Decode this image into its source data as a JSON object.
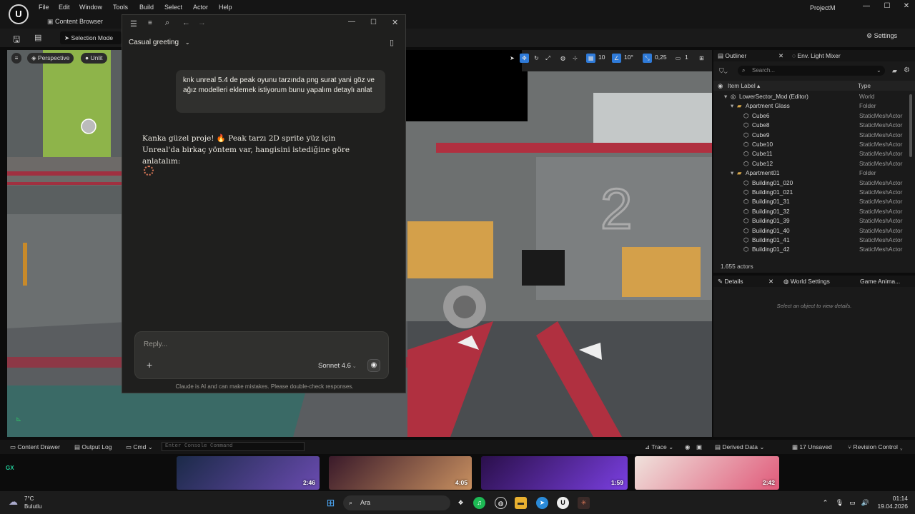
{
  "app": {
    "menu": [
      "File",
      "Edit",
      "Window",
      "Tools",
      "Build",
      "Select",
      "Actor",
      "Help"
    ],
    "project_name": "ProjectM",
    "tab_label": "Content Browser",
    "logo": "ue-logo-icon"
  },
  "toolbar": {
    "selection_mode": "Selection Mode",
    "settings_label": "Settings"
  },
  "viewport": {
    "perspective_label": "Perspective",
    "unlit_label": "Unlit",
    "grid_value": "10",
    "angle_value": "10°",
    "scale_value": "0,25",
    "camera_value": "1"
  },
  "claude": {
    "conversation_title": "Casual greeting",
    "user_message": "knk unreal 5.4 de peak oyunu tarzında png surat yani göz ve ağız modelleri eklemek istiyorum bunu yapalım detaylı anlat",
    "assistant_message": "Kanka güzel proje! 🔥 Peak tarzı 2D sprite yüz için Unreal'da birkaç yöntem var, hangisini istediğine göre anlatalım:",
    "reply_placeholder": "Reply...",
    "model_label": "Sonnet 4.6",
    "disclaimer": "Claude is AI and can make mistakes. Please double-check responses."
  },
  "outliner": {
    "tab_label": "Outliner",
    "tab2_label": "Env. Light Mixer",
    "search_placeholder": "Search...",
    "col_label": "Item Label ▴",
    "col_type": "Type",
    "rows": [
      {
        "label": "LowerSector_Mod (Editor)",
        "type": "World",
        "indent": 0,
        "kind": "world"
      },
      {
        "label": "Apartment Glass",
        "type": "Folder",
        "indent": 1,
        "kind": "folder"
      },
      {
        "label": "Cube6",
        "type": "StaticMeshActor",
        "indent": 2,
        "kind": "mesh"
      },
      {
        "label": "Cube8",
        "type": "StaticMeshActor",
        "indent": 2,
        "kind": "mesh"
      },
      {
        "label": "Cube9",
        "type": "StaticMeshActor",
        "indent": 2,
        "kind": "mesh"
      },
      {
        "label": "Cube10",
        "type": "StaticMeshActor",
        "indent": 2,
        "kind": "mesh"
      },
      {
        "label": "Cube11",
        "type": "StaticMeshActor",
        "indent": 2,
        "kind": "mesh"
      },
      {
        "label": "Cube12",
        "type": "StaticMeshActor",
        "indent": 2,
        "kind": "mesh"
      },
      {
        "label": "Apartment01",
        "type": "Folder",
        "indent": 1,
        "kind": "folder"
      },
      {
        "label": "Building01_020",
        "type": "StaticMeshActor",
        "indent": 2,
        "kind": "mesh"
      },
      {
        "label": "Building01_021",
        "type": "StaticMeshActor",
        "indent": 2,
        "kind": "mesh"
      },
      {
        "label": "Building01_31",
        "type": "StaticMeshActor",
        "indent": 2,
        "kind": "mesh"
      },
      {
        "label": "Building01_32",
        "type": "StaticMeshActor",
        "indent": 2,
        "kind": "mesh"
      },
      {
        "label": "Building01_39",
        "type": "StaticMeshActor",
        "indent": 2,
        "kind": "mesh"
      },
      {
        "label": "Building01_40",
        "type": "StaticMeshActor",
        "indent": 2,
        "kind": "mesh"
      },
      {
        "label": "Building01_41",
        "type": "StaticMeshActor",
        "indent": 2,
        "kind": "mesh"
      },
      {
        "label": "Building01_42",
        "type": "StaticMeshActor",
        "indent": 2,
        "kind": "mesh"
      }
    ],
    "actors_count": "1.655 actors"
  },
  "details": {
    "tab_label": "Details",
    "tab2_label": "World Settings",
    "tab3_label": "Game Anima...",
    "empty_text": "Select an object to view details."
  },
  "statusbar": {
    "content_drawer": "Content Drawer",
    "output_log": "Output Log",
    "cmd": "Cmd",
    "console_placeholder": "Enter Console Command",
    "trace": "Trace",
    "derived_data": "Derived Data",
    "unsaved": "17 Unsaved",
    "revision_control": "Revision Control"
  },
  "thumbnails": [
    {
      "duration": "2:46",
      "color_a": "#1b2a48",
      "color_b": "#6a4bb0"
    },
    {
      "duration": "4:05",
      "color_a": "#3a1a2a",
      "color_b": "#c89060"
    },
    {
      "duration": "1:59",
      "color_a": "#2a0f4a",
      "color_b": "#7a3fe0"
    },
    {
      "duration": "2:42",
      "color_a": "#efe2dc",
      "color_b": "#e05a7a"
    }
  ],
  "taskbar": {
    "weather_temp": "7°C",
    "weather_desc": "Bulutlu",
    "search_label": "Ara",
    "time": "01:14",
    "date": "19.04.2026"
  },
  "colors": {
    "accent": "#d97757",
    "ue_select": "#2f7bd9"
  }
}
